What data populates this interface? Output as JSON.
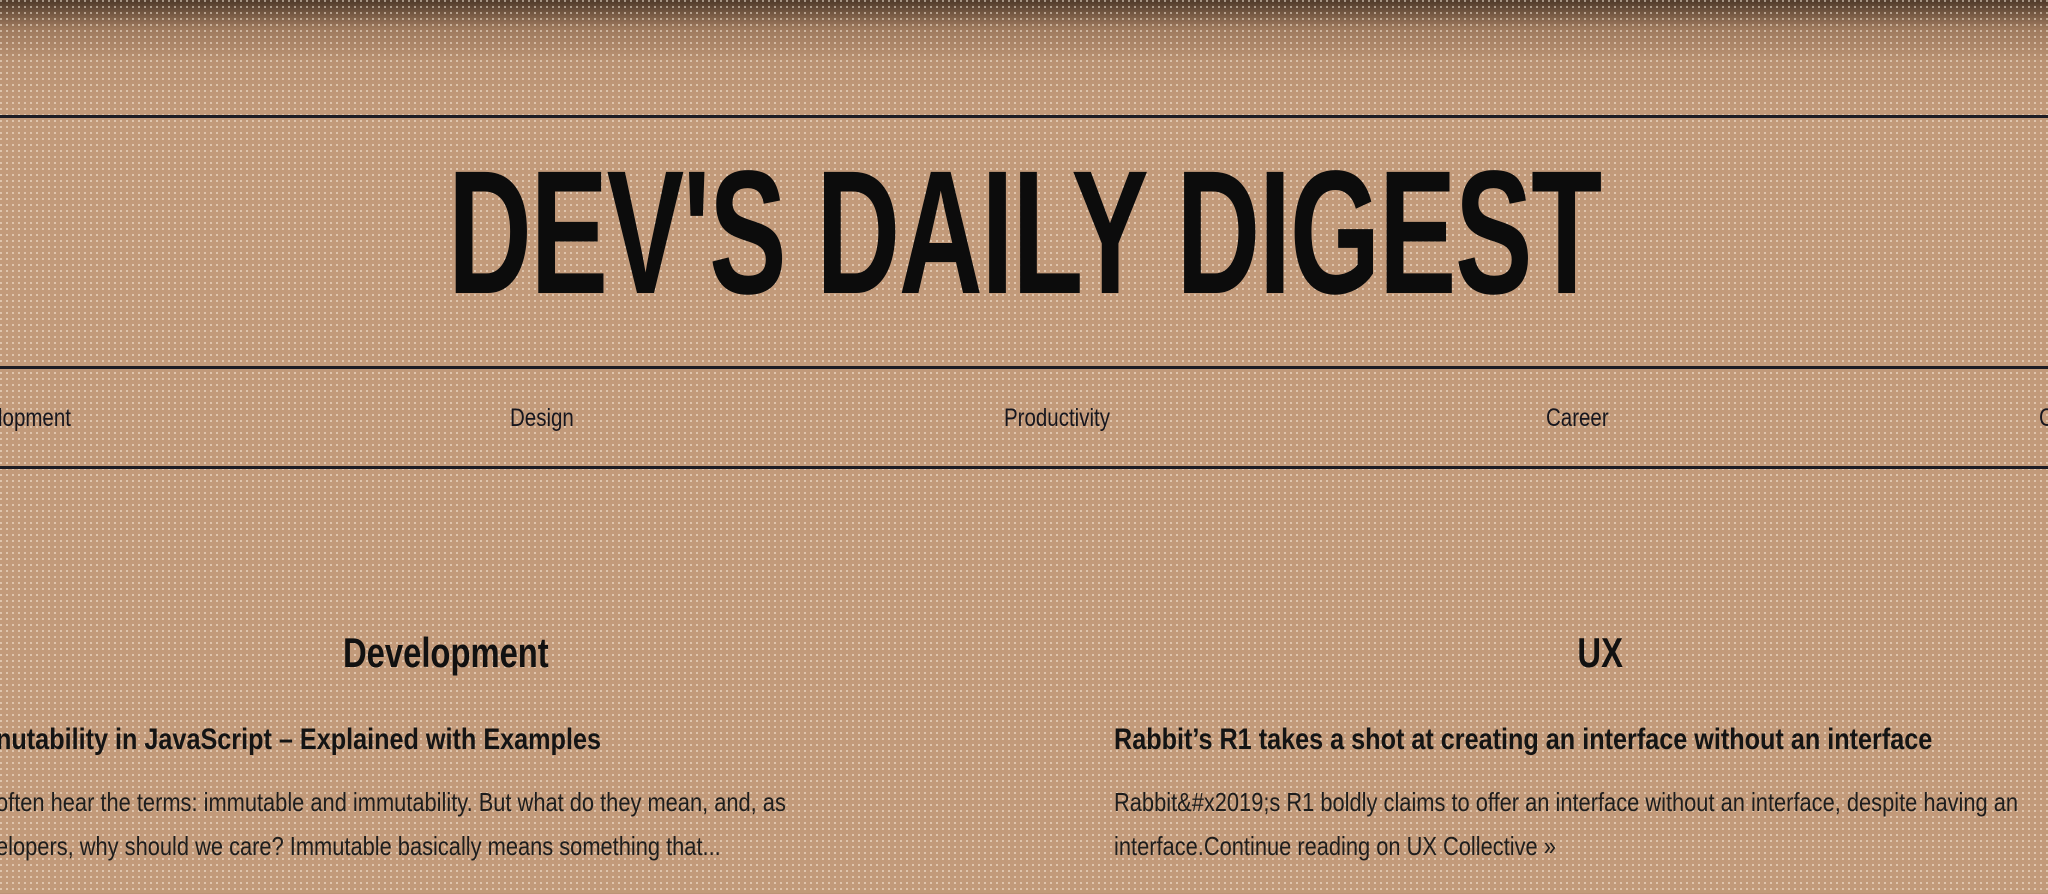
{
  "masthead": {
    "title": "DEV'S DAILY DIGEST"
  },
  "nav": {
    "items": [
      {
        "label": "Development",
        "visible_text": "lopment"
      },
      {
        "label": "Design"
      },
      {
        "label": "Productivity"
      },
      {
        "label": "Career"
      },
      {
        "label": "C",
        "visible_text": "C"
      }
    ]
  },
  "sections": [
    {
      "heading": "Development",
      "article": {
        "title": "nutability in JavaScript – Explained with Examples",
        "excerpt_line1": "often hear the terms: immutable and immutability. But what do they mean, and, as",
        "excerpt_line2": "elopers, why should we care? Immutable basically means something that..."
      }
    },
    {
      "heading": "UX",
      "article": {
        "title": "Rabbit’s R1 takes a shot at creating an interface without an interface",
        "excerpt_line1": "Rabbit&#x2019;s R1 boldly claims to offer an interface without an interface, despite having an",
        "excerpt_line2": "interface.Continue reading on UX Collective »"
      }
    }
  ],
  "colors": {
    "background": "#c29a7a",
    "ink": "#141414",
    "rule": "#1c1c24"
  }
}
